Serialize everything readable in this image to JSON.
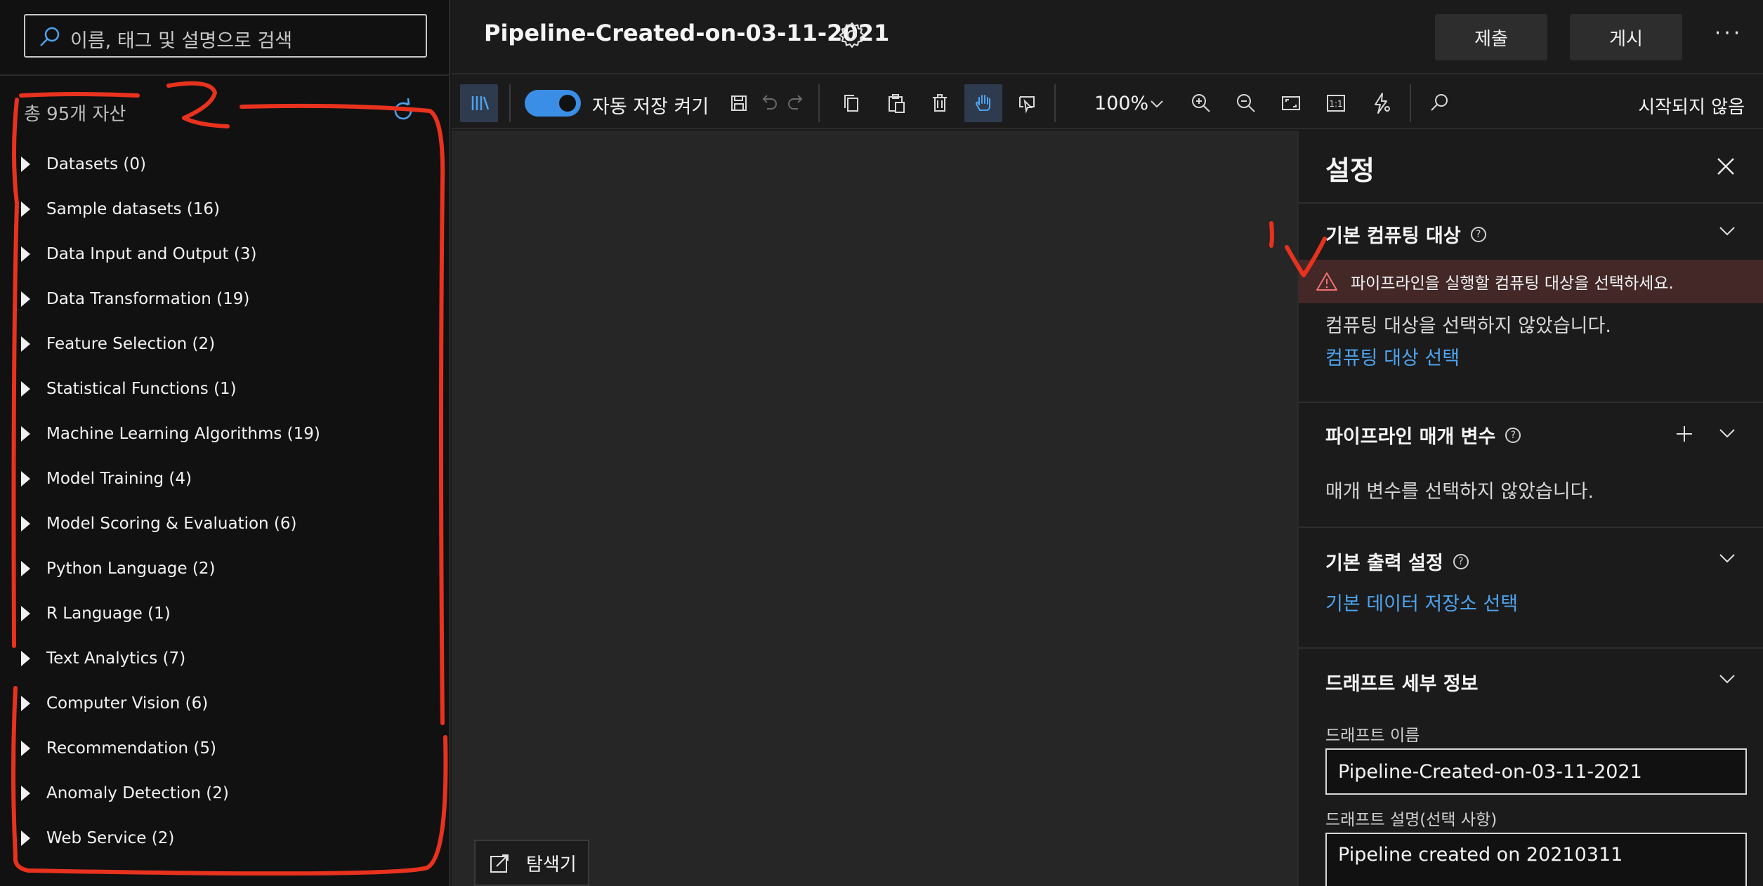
{
  "left_panel": {
    "search_placeholder": "이름, 태그 및 설명으로 검색",
    "asset_count": "총 95개 자산",
    "categories": [
      {
        "label": "Datasets (0)"
      },
      {
        "label": "Sample datasets (16)"
      },
      {
        "label": "Data Input and Output (3)"
      },
      {
        "label": "Data Transformation (19)"
      },
      {
        "label": "Feature Selection (2)"
      },
      {
        "label": "Statistical Functions (1)"
      },
      {
        "label": "Machine Learning Algorithms (19)"
      },
      {
        "label": "Model Training (4)"
      },
      {
        "label": "Model Scoring & Evaluation (6)"
      },
      {
        "label": "Python Language (2)"
      },
      {
        "label": "R Language (1)"
      },
      {
        "label": "Text Analytics (7)"
      },
      {
        "label": "Computer Vision (6)"
      },
      {
        "label": "Recommendation (5)"
      },
      {
        "label": "Anomaly Detection (2)"
      },
      {
        "label": "Web Service (2)"
      }
    ]
  },
  "header": {
    "title": "Pipeline-Created-on-03-11-2021",
    "submit_label": "제출",
    "publish_label": "게시",
    "more_label": "···"
  },
  "toolbar": {
    "autosave_label": "자동 저장 켜기",
    "autosave_on": true,
    "zoom": "100%",
    "status": "시작되지 않음",
    "accent_color": "#3a8ee6"
  },
  "canvas": {
    "explorer_label": "탐색기"
  },
  "settings": {
    "title": "설정",
    "compute": {
      "title": "기본 컴퓨팅 대상",
      "warning": "파이프라인을 실행할 컴퓨팅 대상을 선택하세요.",
      "status": "컴퓨팅 대상을 선택하지 않았습니다.",
      "link": "컴퓨팅 대상 선택"
    },
    "parameters": {
      "title": "파이프라인 매개 변수",
      "status": "매개 변수를 선택하지 않았습니다."
    },
    "output": {
      "title": "기본 출력 설정",
      "link": "기본 데이터 저장소 선택"
    },
    "draft": {
      "title": "드래프트 세부 정보",
      "name_label": "드래프트 이름",
      "name_value": "Pipeline-Created-on-03-11-2021",
      "desc_label": "드래프트 설명(선택 사항)",
      "desc_value": "Pipeline created on 20210311"
    }
  },
  "annotations": {
    "color": "#e8321e",
    "marks": [
      "1",
      "2"
    ]
  }
}
